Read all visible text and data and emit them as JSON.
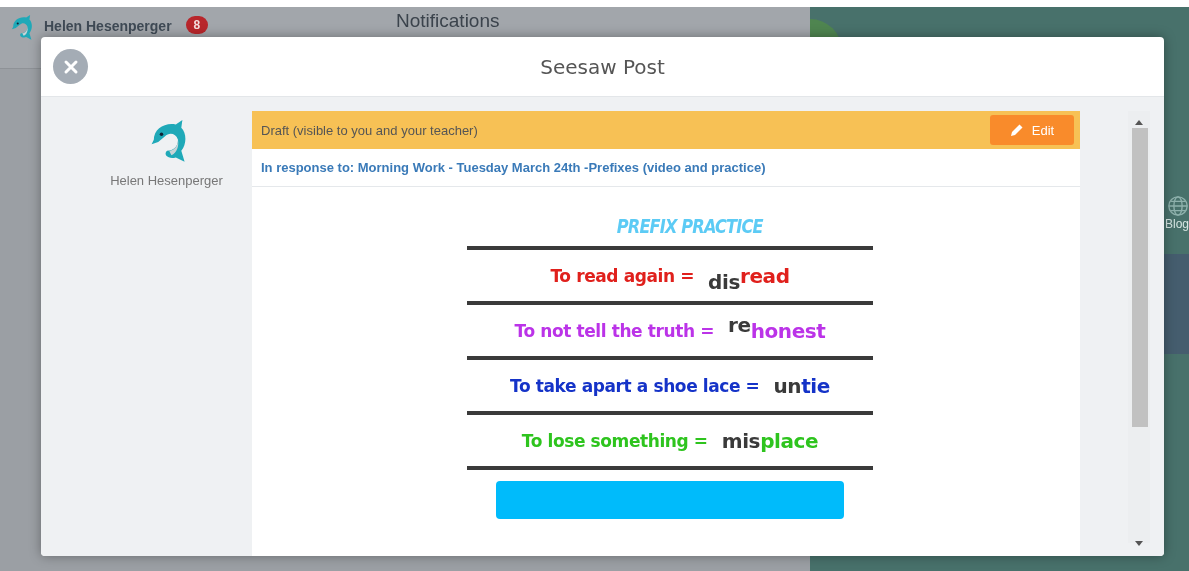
{
  "background": {
    "user_name": "Helen Hesenperger",
    "notification_count": "8",
    "heading": "Notifications",
    "blog_label": "Blog"
  },
  "modal": {
    "title": "Seesaw Post",
    "author": {
      "name": "Helen Hesenperger"
    },
    "post": {
      "status": "Draft (visible to you and your teacher)",
      "edit_button": "Edit",
      "response_to": "In response to: Morning Work - Tuesday March 24th -Prefixes (video and practice)",
      "worksheet": {
        "title": "PREFIX PRACTICE",
        "rows": [
          {
            "prompt": "To read again =",
            "prefix": "dis",
            "root": "read",
            "color": "#e0201c"
          },
          {
            "prompt": "To not tell the truth =",
            "prefix": "re",
            "root": "honest",
            "color": "#bb33e8"
          },
          {
            "prompt": "To take apart a shoe lace =",
            "prefix": "un",
            "root": "tie",
            "color": "#1533c8"
          },
          {
            "prompt": "To lose something =",
            "prefix": "mis",
            "root": "place",
            "color": "#2ec41e"
          }
        ]
      }
    }
  }
}
